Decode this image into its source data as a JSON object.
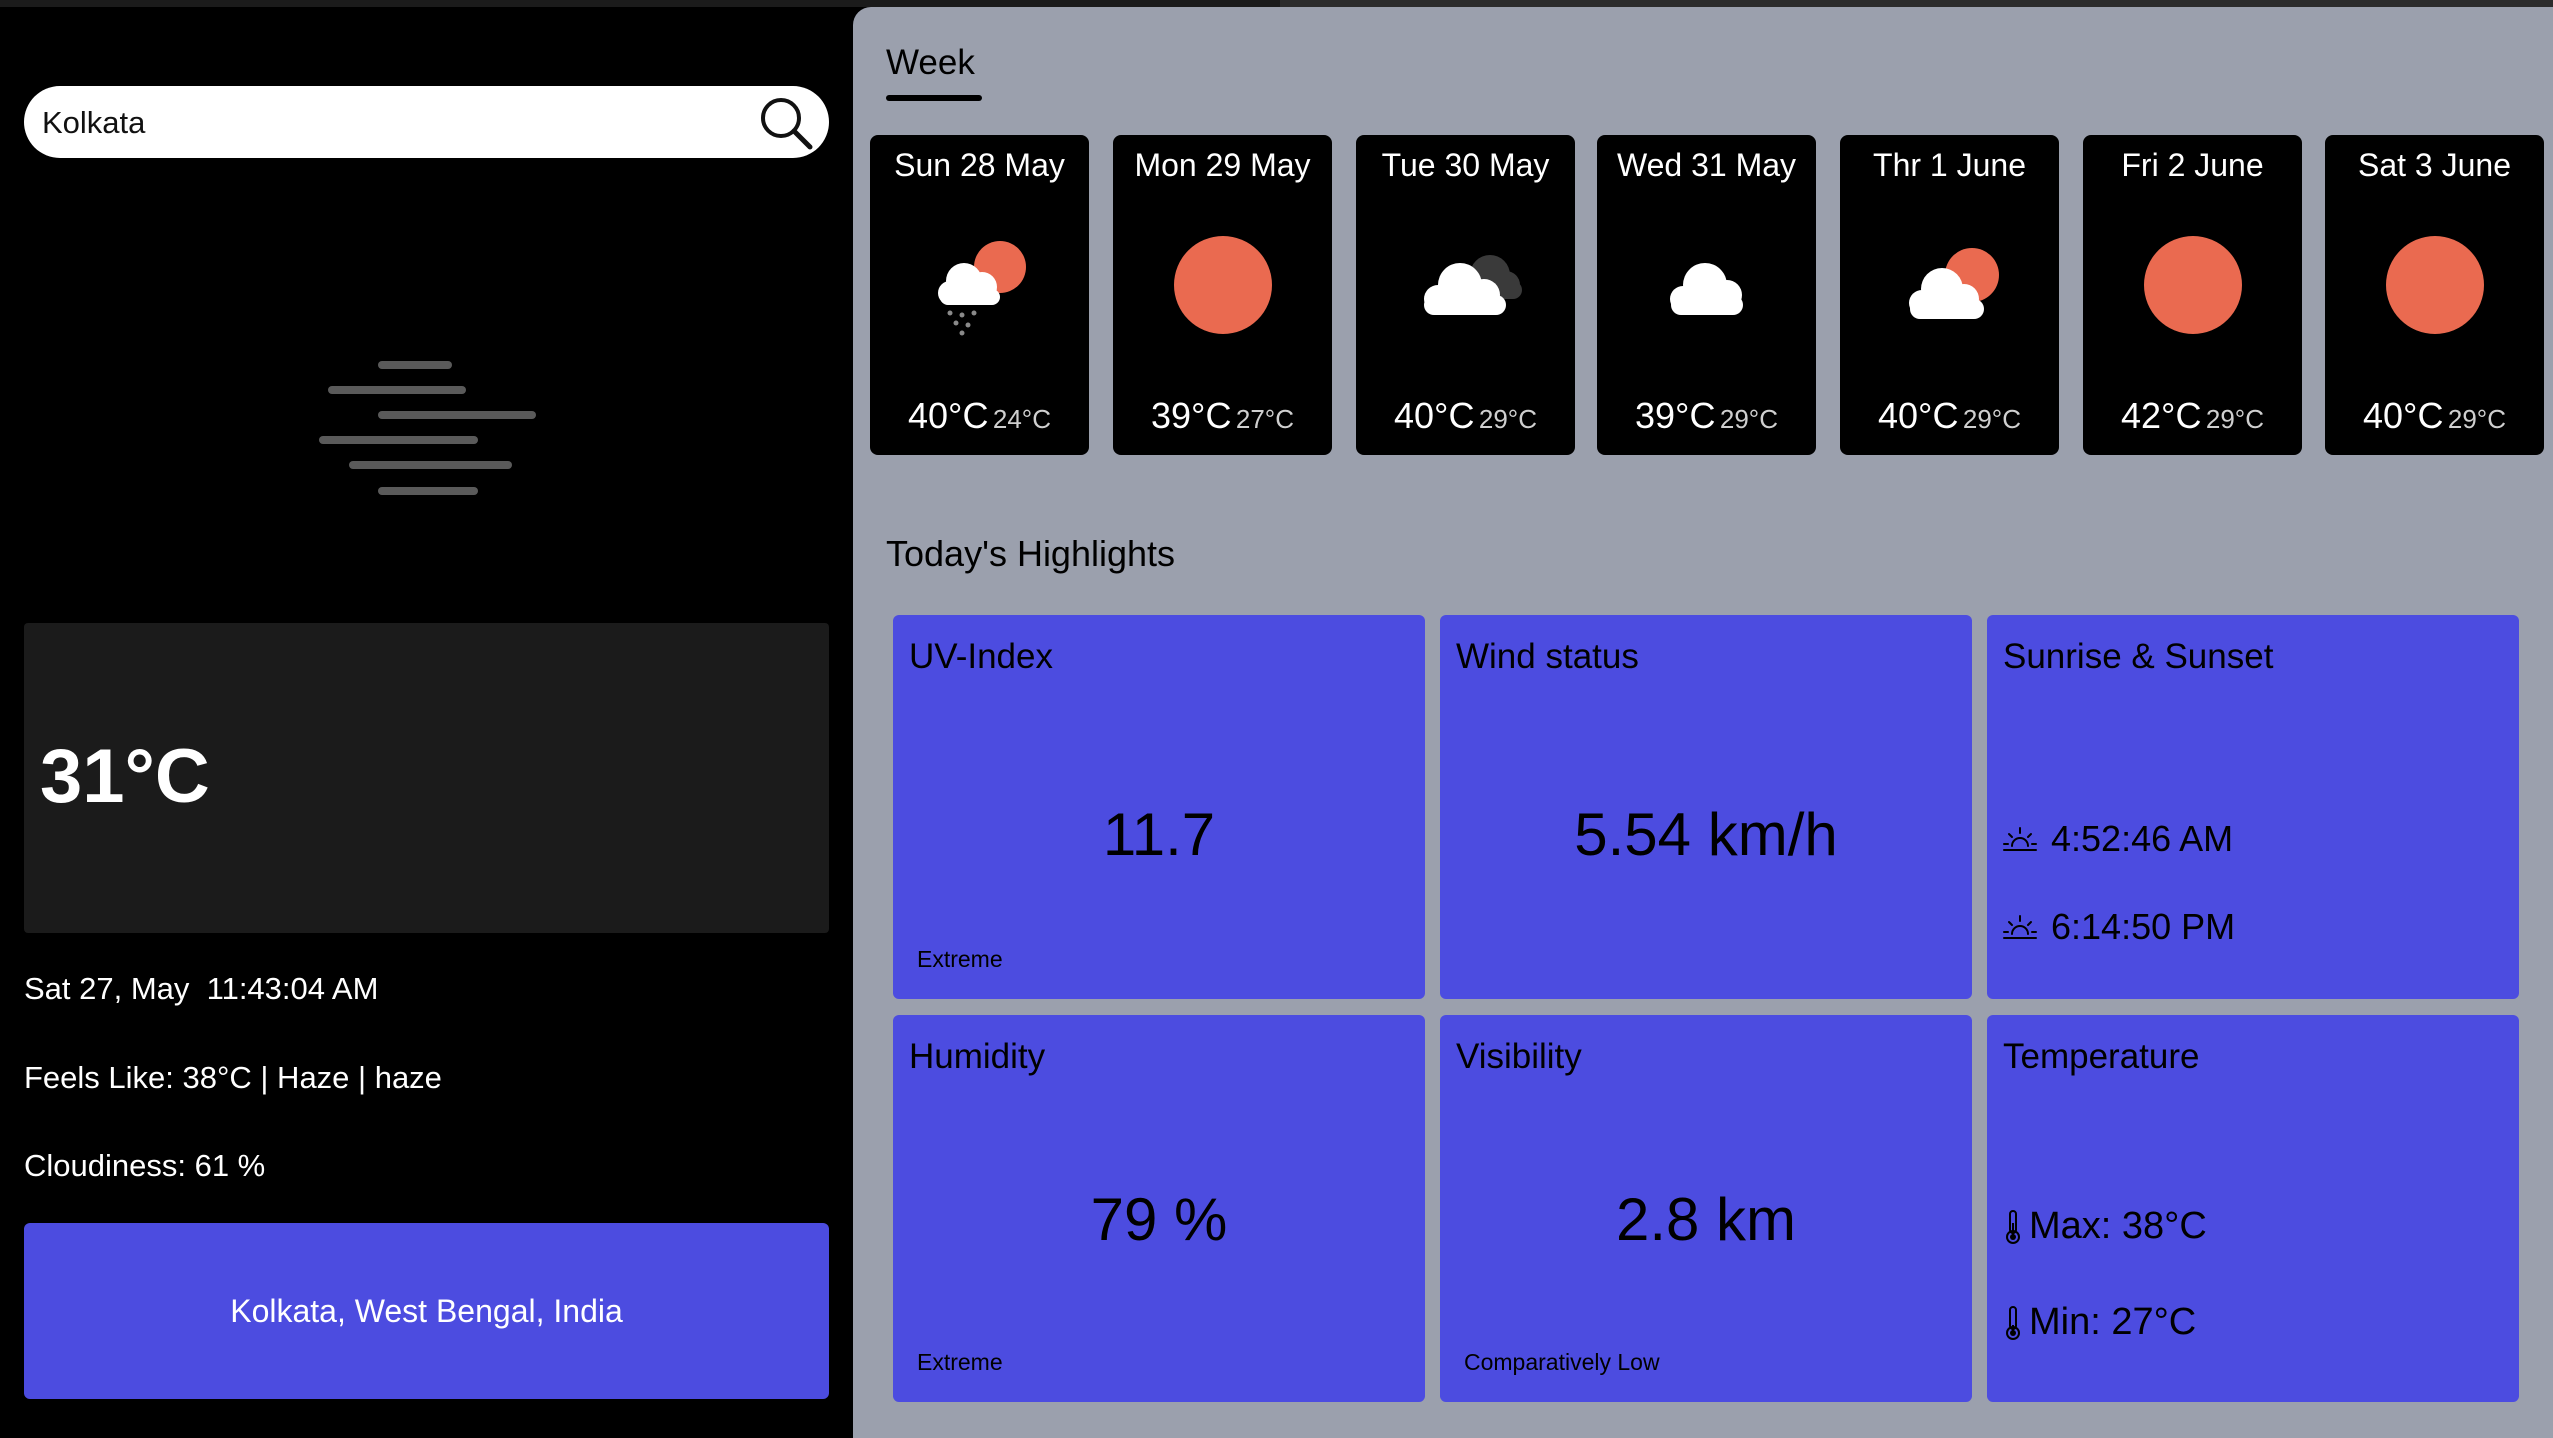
{
  "search": {
    "value": "Kolkata"
  },
  "current": {
    "icon": "haze-icon",
    "temperature": "31°C",
    "datetime": "Sat 27, May  11:43:04 AM",
    "feels_like": "Feels Like: 38°C | Haze | haze",
    "cloudiness": "Cloudiness: 61 %",
    "location": "Kolkata, West Bengal, India"
  },
  "week": {
    "tab_label": "Week",
    "days": [
      {
        "name": "Sun 28 May",
        "max": "40°C",
        "min": "24°C",
        "icon": "rain-cloud-sun-icon"
      },
      {
        "name": "Mon 29 May",
        "max": "39°C",
        "min": "27°C",
        "icon": "sun-icon"
      },
      {
        "name": "Tue 30 May",
        "max": "40°C",
        "min": "29°C",
        "icon": "broken-clouds-icon"
      },
      {
        "name": "Wed 31 May",
        "max": "39°C",
        "min": "29°C",
        "icon": "cloud-icon"
      },
      {
        "name": "Thr 1 June",
        "max": "40°C",
        "min": "29°C",
        "icon": "cloud-sun-icon"
      },
      {
        "name": "Fri 2 June",
        "max": "42°C",
        "min": "29°C",
        "icon": "sun-icon"
      },
      {
        "name": "Sat 3 June",
        "max": "40°C",
        "min": "29°C",
        "icon": "sun-icon"
      }
    ]
  },
  "highlights": {
    "title": "Today's Highlights",
    "uv": {
      "label": "UV-Index",
      "value": "11.7",
      "note": "Extreme"
    },
    "wind": {
      "label": "Wind status",
      "value": "5.54 km/h"
    },
    "sun": {
      "label": "Sunrise & Sunset",
      "sunrise": "4:52:46 AM",
      "sunset": "6:14:50 PM"
    },
    "humidity": {
      "label": "Humidity",
      "value": "79 %"
    },
    "visibility": {
      "label": "Visibility",
      "value": "2.8 km",
      "note": "Comparatively Low"
    },
    "temperature": {
      "label": "Temperature",
      "max": "Max: 38°C",
      "min": "Min: 27°C"
    }
  },
  "colors": {
    "accent": "#4c4ce0",
    "sun": "#ea6a50",
    "right_panel_bg": "#9ba0ad"
  }
}
